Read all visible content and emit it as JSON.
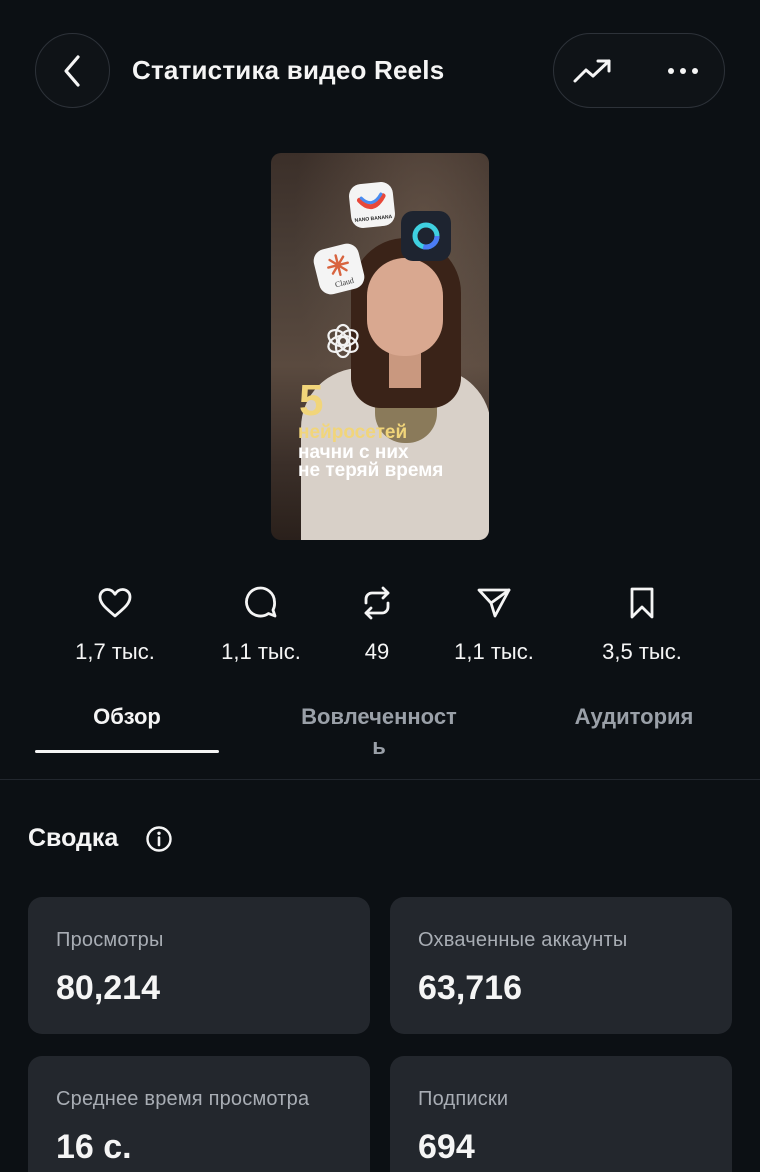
{
  "header": {
    "title": "Статистика видео Reels"
  },
  "thumbnail": {
    "overlay_number": "5",
    "overlay_line1": "нейросетей",
    "overlay_line2": "начни с них",
    "overlay_line3": "не теряй время",
    "nano_label": "NANO BANANA",
    "claude_label": "Claud"
  },
  "stats": {
    "likes": "1,7 тыс.",
    "comments": "1,1 тыс.",
    "reposts": "49",
    "shares": "1,1 тыс.",
    "saves": "3,5 тыс."
  },
  "tabs": {
    "overview": "Обзор",
    "engagement_part1": "Вовлеченност",
    "engagement_part2": "ь",
    "audience": "Аудитория",
    "active": "overview"
  },
  "summary": {
    "title": "Сводка",
    "cards": {
      "views_label": "Просмотры",
      "views_value": "80,214",
      "reach_label": "Охваченные аккаунты",
      "reach_value": "63,716",
      "avgtime_label": "Среднее время просмотра",
      "avgtime_value": "16 с.",
      "follows_label": "Подписки",
      "follows_value": "694"
    }
  },
  "colors": {
    "background": "#0c1014",
    "card": "#23272d",
    "text_primary": "#f5f5f5",
    "text_secondary": "#a8adb4",
    "overlay_accent": "#f1d57a"
  },
  "icons": {
    "back": "chevron-left-icon",
    "trend": "trending-up-icon",
    "more": "more-horizontal-icon",
    "likes": "heart-icon",
    "comments": "comment-icon",
    "reposts": "repost-icon",
    "shares": "send-icon",
    "saves": "bookmark-icon",
    "info": "info-icon"
  }
}
